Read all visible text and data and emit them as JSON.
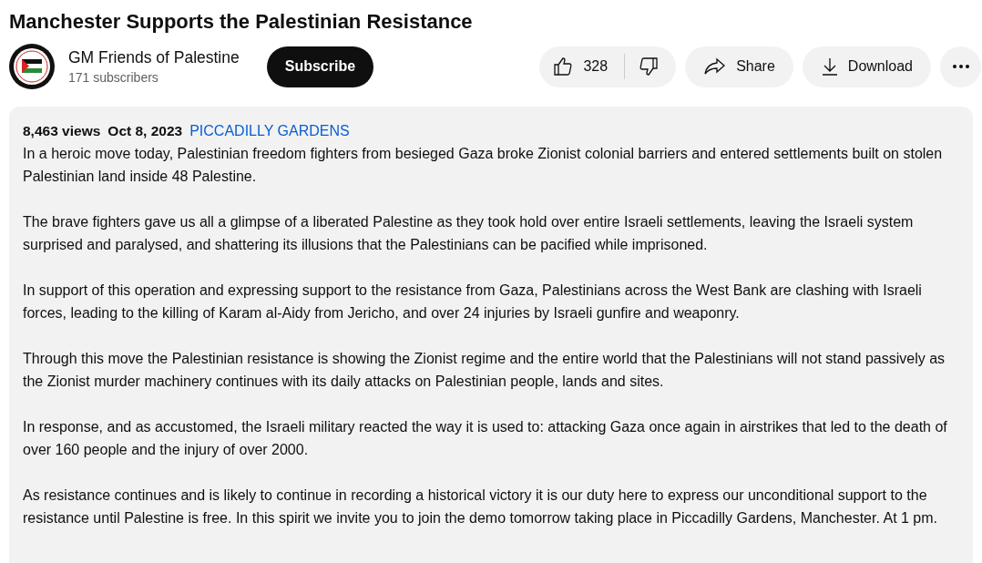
{
  "video": {
    "title": "Manchester Supports the Palestinian Resistance"
  },
  "channel": {
    "name": "GM Friends of Palestine",
    "subscribers": "171 subscribers",
    "subscribe_label": "Subscribe"
  },
  "actions": {
    "likes": "328",
    "share": "Share",
    "download": "Download"
  },
  "description": {
    "views": "8,463 views",
    "date": "Oct 8, 2023",
    "hashtag": "PICCADILLY GARDENS",
    "paragraphs": [
      "In a heroic move today, Palestinian freedom fighters from besieged Gaza broke Zionist colonial barriers and entered settlements built on stolen Palestinian land inside 48 Palestine.",
      "The brave fighters gave us all a glimpse of a liberated Palestine as they took hold over entire Israeli settlements, leaving the Israeli system surprised and paralysed, and shattering its illusions that the Palestinians can be pacified while imprisoned.",
      "In support of this operation and expressing support to the resistance from Gaza, Palestinians across the West Bank are clashing with Israeli forces, leading to the killing of Karam al-Aidy from Jericho, and over 24 injuries by Israeli gunfire and weaponry.",
      "Through this move the Palestinian resistance is showing the Zionist regime and the entire world that the Palestinians will not stand passively as the Zionist murder machinery continues with its daily attacks on Palestinian people, lands and sites.",
      "In response, and as accustomed, the Israeli military reacted the way it is used to: attacking Gaza once again in airstrikes that led to the death of over 160 people and the injury of over 2000.",
      "As resistance continues and is likely to continue in recording a historical victory it is our duty here to express our unconditional support to the resistance until Palestine is free. In this spirit we invite you to join the demo tomorrow taking place in Piccadilly Gardens, Manchester. At 1 pm."
    ]
  }
}
